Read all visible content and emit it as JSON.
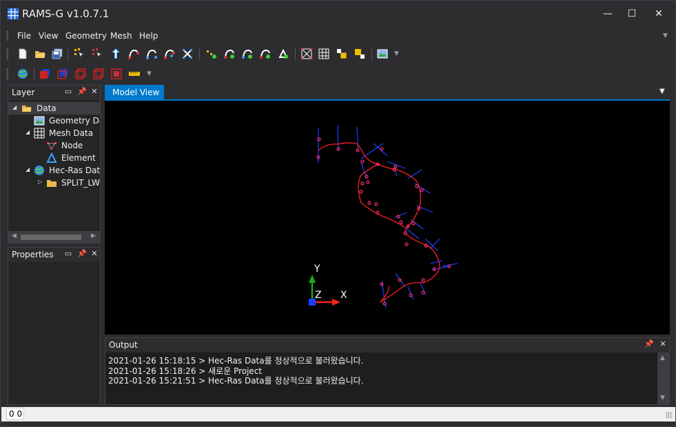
{
  "app": {
    "title": "RAMS-G v1.0.7.1",
    "window_controls": {
      "minimize": "—",
      "maximize": "☐",
      "close": "✕"
    }
  },
  "menu": {
    "items": [
      "File",
      "View",
      "Geometry",
      "Mesh",
      "Help"
    ],
    "overflow_icon": "chevron-down-icon"
  },
  "toolbar1": {
    "icons": [
      "new-file-icon",
      "open-folder-icon",
      "save-icon",
      "select-node-icon",
      "add-node-icon",
      "move-node-icon",
      "draw-line-icon",
      "edit-line-icon",
      "split-line-icon",
      "delete-line-icon",
      "mesh-select-icon",
      "node-add-icon",
      "line-add-icon",
      "line-insert-icon",
      "line-split-icon",
      "node-star-icon",
      "mesh-generate-icon",
      "mesh-grid-icon",
      "mesh-export-icon",
      "mesh-import-icon",
      "geometry-view-icon",
      "toolbar-overflow-icon"
    ]
  },
  "toolbar2": {
    "icons": [
      "globe-icon",
      "box-solid-icon",
      "box-front-icon",
      "box-right-icon",
      "box-top-icon",
      "box-side-icon",
      "ruler-icon",
      "toolbar-overflow-icon"
    ]
  },
  "layer_panel": {
    "title": "Layer",
    "tree": [
      {
        "label": "Data",
        "icon": "folder-open-icon",
        "expanded": true,
        "selected": true,
        "level": 0
      },
      {
        "label": "Geometry Dat",
        "icon": "geometry-icon",
        "level": 1
      },
      {
        "label": "Mesh Data",
        "icon": "mesh-icon",
        "expanded": true,
        "level": 1
      },
      {
        "label": "Node",
        "icon": "node-icon",
        "level": 2
      },
      {
        "label": "Element",
        "icon": "element-icon",
        "level": 2
      },
      {
        "label": "Hec-Ras Data",
        "icon": "globe-icon",
        "expanded": true,
        "level": 1
      },
      {
        "label": "SPLIT_LW",
        "icon": "folder-icon",
        "expanded": false,
        "level": 2
      }
    ]
  },
  "properties_panel": {
    "title": "Properties"
  },
  "model_view": {
    "tab_label": "Model View",
    "axes": {
      "y": "Y",
      "z": "Z",
      "x": "X"
    },
    "colors": {
      "river_line": "#ff2020",
      "cross_section": "#2040ff",
      "node": "#ff3070",
      "axis_y": "#1ea81e",
      "axis_x": "#ff2020",
      "axis_z": "#1c3cff"
    }
  },
  "output_panel": {
    "title": "Output",
    "lines": [
      "2021-01-26 15:18:15 > Hec-Ras Data를 정상적으로 불러왔습니다.",
      "2021-01-26 15:18:26 > 새로운 Project",
      "2021-01-26 15:21:51 > Hec-Ras Data를 정상적으로 불러왔습니다."
    ]
  },
  "status": {
    "coords": "0 0"
  }
}
